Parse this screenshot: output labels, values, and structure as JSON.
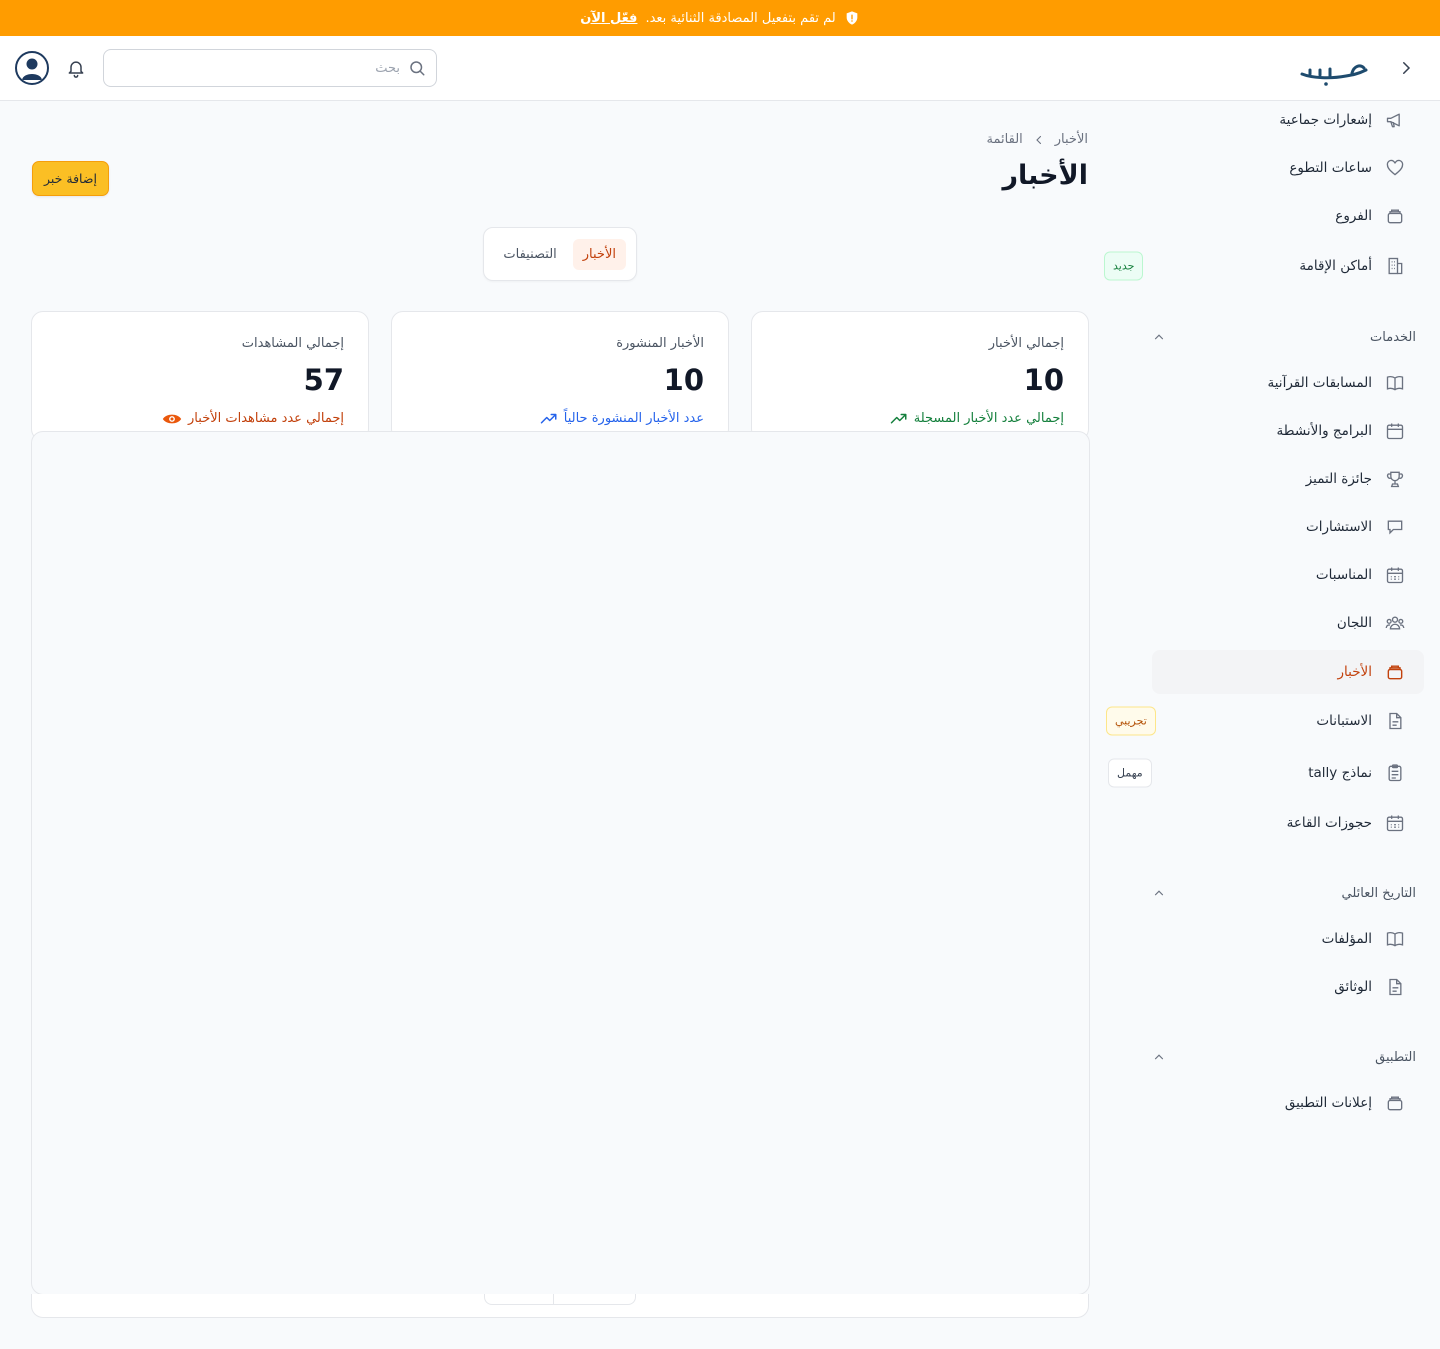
{
  "banner": {
    "message": "لم تقم بتفعيل المصادقة الثنائية بعد.",
    "action": "فعّل الآن",
    "icon": "shield-alert-icon"
  },
  "header": {
    "logo_text": "حسب",
    "search_placeholder": "بحث",
    "search_value": "",
    "icons": [
      "chevron-right-icon",
      "bell-icon",
      "user-avatar-icon",
      "search-icon"
    ]
  },
  "sidebar": {
    "top_items": [
      {
        "label": "إشعارات جماعية",
        "icon": "megaphone-icon"
      },
      {
        "label": "ساعات التطوع",
        "icon": "heart-icon"
      },
      {
        "label": "الفروع",
        "icon": "stack-icon"
      },
      {
        "label": "أماكن الإقامة",
        "icon": "building-icon",
        "badge": "جديد"
      }
    ],
    "services": {
      "title": "الخدمات",
      "items": [
        {
          "label": "المسابقات القرآنية",
          "icon": "book-icon"
        },
        {
          "label": "البرامج والأنشطة",
          "icon": "calendar-icon"
        },
        {
          "label": "جائزة التميز",
          "icon": "trophy-icon"
        },
        {
          "label": "الاستشارات",
          "icon": "chat-icon"
        },
        {
          "label": "المناسبات",
          "icon": "calendar-grid-icon"
        },
        {
          "label": "اللجان",
          "icon": "users-icon"
        },
        {
          "label": "الأخبار",
          "icon": "stack-icon",
          "active": true
        },
        {
          "label": "الاستبانات",
          "icon": "document-icon",
          "badge": "تجريبي"
        },
        {
          "label": "نماذج tally",
          "icon": "clipboard-icon",
          "badge": "مهمل"
        },
        {
          "label": "حجوزات القاعة",
          "icon": "calendar-grid-icon"
        }
      ]
    },
    "family_history": {
      "title": "التاريخ العائلي",
      "items": [
        {
          "label": "المؤلفات",
          "icon": "book-icon"
        },
        {
          "label": "الوثائق",
          "icon": "document-icon"
        }
      ]
    },
    "app": {
      "title": "التطبيق",
      "items": [
        {
          "label": "إعلانات التطبيق",
          "icon": "stack-icon"
        }
      ]
    }
  },
  "main": {
    "breadcrumb": [
      "الأخبار",
      "القائمة"
    ],
    "title": "الأخبار",
    "add_button": "إضافة خبر",
    "tabs": [
      {
        "label": "الأخبار",
        "active": true
      },
      {
        "label": "التصنيفات",
        "active": false
      }
    ],
    "stats": [
      {
        "label": "إجمالي الأخبار",
        "value": "10",
        "sub": "إجمالي عدد الأخبار المسجلة",
        "sub_icon": "trend-up-icon",
        "color": "#15803d"
      },
      {
        "label": "الأخبار المنشورة",
        "value": "10",
        "sub": "عدد الأخبار المنشورة حالياً",
        "sub_icon": "trend-up-icon",
        "color": "#2563eb"
      },
      {
        "label": "إجمالي المشاهدات",
        "value": "57",
        "sub": "إجمالي عدد مشاهدات الأخبار",
        "sub_icon": "eye-icon",
        "color": "#c2410c"
      }
    ]
  },
  "colors": {
    "banner": "#ff9c00",
    "accent": "#c2410c",
    "add_button": "#fbbf24"
  }
}
